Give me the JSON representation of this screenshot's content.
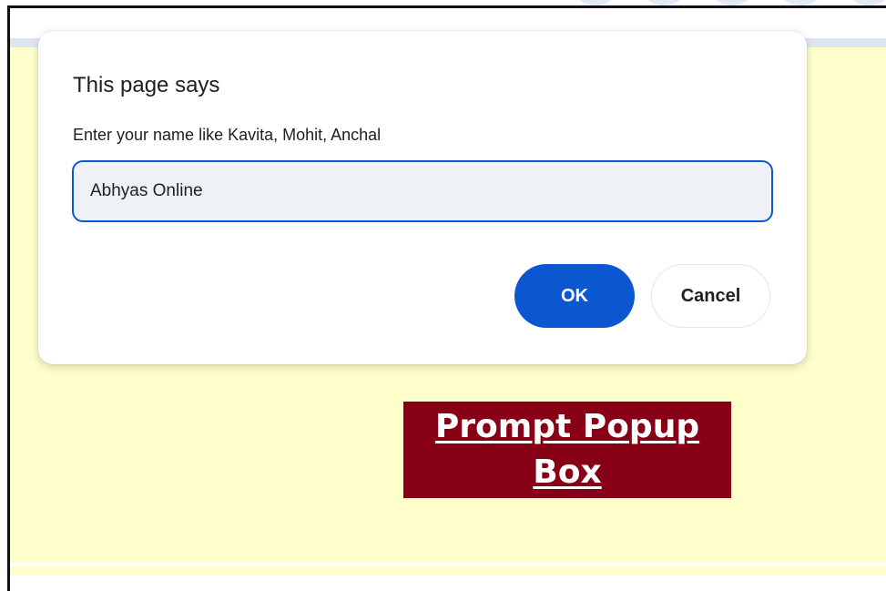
{
  "dialog": {
    "title": "This page says",
    "message": "Enter your name like Kavita, Mohit, Anchal",
    "input_value": "Abhyas Online",
    "ok_label": "OK",
    "cancel_label": "Cancel"
  },
  "page": {
    "heading_line1": "Prompt Popup",
    "heading_line2": "Box"
  },
  "colors": {
    "page_background": "#ffffcc",
    "heading_background": "#880015",
    "heading_text": "#ffffff",
    "accent": "#0b57d0"
  }
}
